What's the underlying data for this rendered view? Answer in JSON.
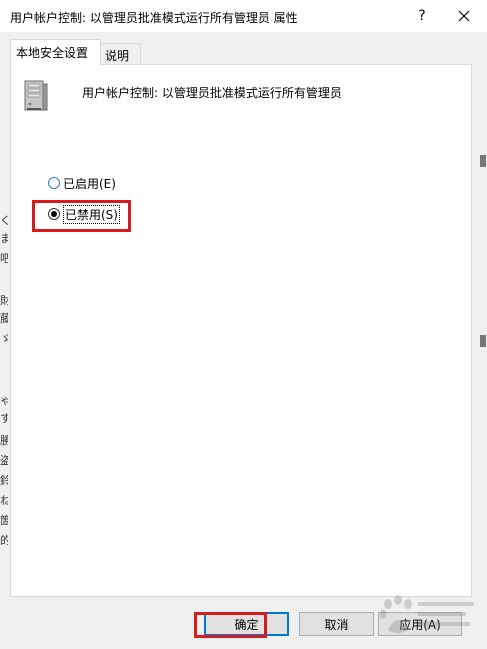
{
  "window": {
    "title": "用户帐户控制: 以管理员批准模式运行所有管理员 属性",
    "help_glyph": "?",
    "close_icon": "close-icon"
  },
  "tabs": [
    {
      "label": "本地安全设置",
      "active": true
    },
    {
      "label": "说明",
      "active": false
    }
  ],
  "policy": {
    "icon": "server-icon",
    "name": "用户帐户控制: 以管理员批准模式运行所有管理员"
  },
  "options": {
    "enabled": {
      "label": "已启用(E)",
      "checked": false
    },
    "disabled": {
      "label": "已禁用(S)",
      "checked": true
    }
  },
  "buttons": {
    "ok": "确定",
    "cancel": "取消",
    "apply": "应用(A)"
  },
  "background_fragments": [
    "く",
    "ま",
    "吧",
    "財",
    "藤",
    "ゞ",
    "ゃ",
    "す",
    "勝",
    "盗",
    "鈴",
    "ね",
    "箇",
    "的"
  ],
  "colors": {
    "annotation_red": "#d61d1d",
    "focus_blue": "#0078d7",
    "dialog_bg": "#f0f0f0"
  }
}
